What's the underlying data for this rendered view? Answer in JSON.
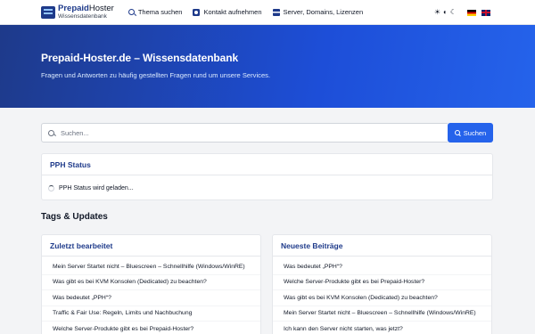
{
  "nav": {
    "brand_name_bold": "Prepaid",
    "brand_name_rest": "Hoster",
    "brand_sub": "Wissensdatenbank",
    "links": [
      {
        "label": "Thema suchen",
        "icon": "search-icon"
      },
      {
        "label": "Kontakt aufnehmen",
        "icon": "contact-icon"
      },
      {
        "label": "Server, Domains, Lizenzen",
        "icon": "server-icon"
      }
    ],
    "theme_icons": [
      "☀",
      "◐",
      "☾"
    ],
    "languages": [
      "de",
      "en"
    ]
  },
  "hero": {
    "title": "Prepaid-Hoster.de – Wissensdatenbank",
    "subtitle": "Fragen und Antworten zu häufig gestellten Fragen rund um unsere Services."
  },
  "search": {
    "placeholder": "Suchen...",
    "button_label": "Suchen"
  },
  "status": {
    "title": "PPH Status",
    "loading_text": "PPH Status wird geladen..."
  },
  "tags": {
    "title": "Tags & Updates"
  },
  "recently_edited": {
    "title": "Zuletzt bearbeitet",
    "items": [
      "Mein Server Startet nicht – Bluescreen – Schnellhilfe (Windows/WinRE)",
      "Was gibt es bei KVM Konsolen (Dedicated) zu beachten?",
      "Was bedeutet „PPH“?",
      "Traffic & Fair Use: Regeln, Limits und Nachbuchung",
      "Welche Server-Produkte gibt es bei Prepaid-Hoster?"
    ]
  },
  "latest_posts": {
    "title": "Neueste Beiträge",
    "items": [
      "Was bedeutet „PPH“?",
      "Welche Server-Produkte gibt es bei Prepaid-Hoster?",
      "Was gibt es bei KVM Konsolen (Dedicated) zu beachten?",
      "Mein Server Startet nicht – Bluescreen – Schnellhilfe (Windows/WinRE)",
      "Ich kann den Server nicht starten, was jetzt?"
    ]
  },
  "colors": {
    "primary": "#1e3a8a",
    "accent": "#2563eb",
    "background": "#f3f4f6"
  }
}
